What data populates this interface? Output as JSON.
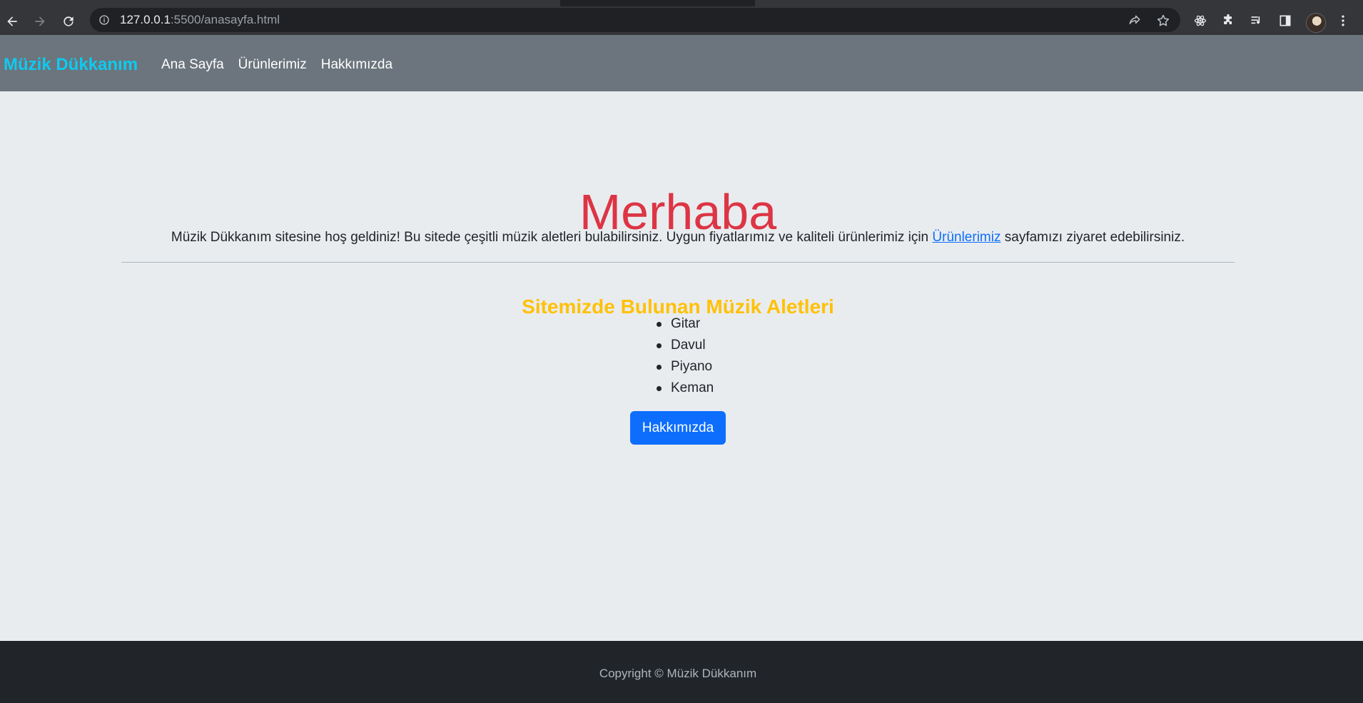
{
  "browser": {
    "url_host": "127.0.0.1",
    "url_rest": ":5500/anasayfa.html"
  },
  "navbar": {
    "brand": "Müzik Dükkanım",
    "links": [
      "Ana Sayfa",
      "Ürünlerimiz",
      "Hakkımızda"
    ],
    "background": "#6c757d",
    "brand_color": "#0dcaf0"
  },
  "hero": {
    "title": "Merhaba",
    "title_color": "#dc3545",
    "text_before": "Müzik Dükkanım sitesine hoş geldiniz! Bu sitede çeşitli müzik aletleri bulabilirsiniz. Uygun fiyatlarımız ve kaliteli ürünlerimiz için ",
    "text_link": "Ürünlerimiz",
    "text_after": " sayfamızı ziyaret edebilirsiniz."
  },
  "instruments": {
    "heading": "Sitemizde Bulunan Müzik Aletleri",
    "heading_color": "#ffc107",
    "items": [
      "Gitar",
      "Davul",
      "Piyano",
      "Keman"
    ]
  },
  "about_button": {
    "label": "Hakkımızda",
    "color": "#0d6efd"
  },
  "footer": {
    "text": "Copyright © Müzik Dükkanım",
    "background": "#212529"
  },
  "chrome_icons": [
    "back-icon",
    "forward-icon",
    "reload-icon",
    "info-icon",
    "share-icon",
    "star-icon",
    "react-devtools-icon",
    "extensions-icon",
    "media-control-icon",
    "side-panel-icon",
    "profile-avatar",
    "menu-icon"
  ]
}
